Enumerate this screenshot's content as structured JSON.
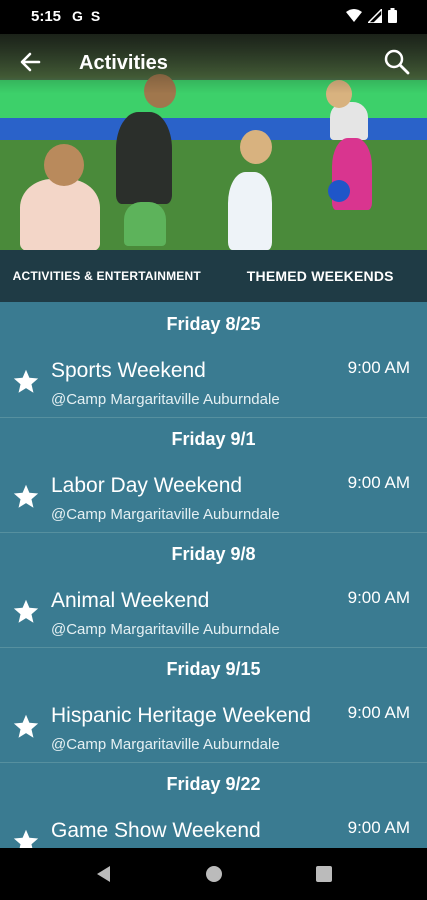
{
  "status_bar": {
    "time": "5:15",
    "left_icons": [
      "G",
      "S"
    ],
    "right_icons": [
      "wifi-icon",
      "signal-icon",
      "battery-icon"
    ]
  },
  "app_bar": {
    "title": "Activities",
    "back_icon": "arrow-left-icon",
    "search_icon": "search-icon"
  },
  "tabs": [
    {
      "label": "ACTIVITIES & ENTERTAINMENT"
    },
    {
      "label": "THEMED WEEKENDS"
    }
  ],
  "days": [
    {
      "date": "Friday 8/25",
      "event": {
        "name": "Sports Weekend",
        "location": "@Camp Margaritaville Auburndale",
        "time": "9:00 AM"
      }
    },
    {
      "date": "Friday 9/1",
      "event": {
        "name": "Labor Day Weekend",
        "location": "@Camp Margaritaville Auburndale",
        "time": "9:00 AM"
      }
    },
    {
      "date": "Friday 9/8",
      "event": {
        "name": "Animal Weekend",
        "location": "@Camp Margaritaville Auburndale",
        "time": "9:00 AM"
      }
    },
    {
      "date": "Friday 9/15",
      "event": {
        "name": "Hispanic Heritage Weekend",
        "location": "@Camp Margaritaville Auburndale",
        "time": "9:00 AM"
      }
    },
    {
      "date": "Friday 9/22",
      "event": {
        "name": "Game Show Weekend",
        "location": "",
        "time": "9:00 AM"
      }
    }
  ],
  "colors": {
    "list_bg": "#3a7b91",
    "tab_bg": "#1f3b45"
  },
  "nav_bar": {
    "buttons": [
      "back-triangle-icon",
      "home-circle-icon",
      "recents-square-icon"
    ]
  }
}
